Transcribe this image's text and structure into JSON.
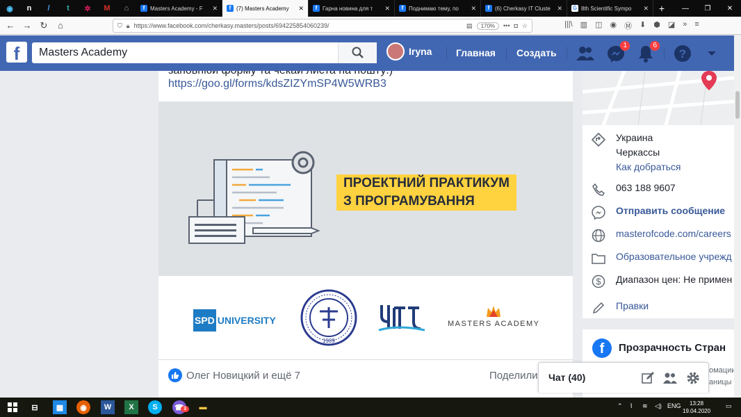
{
  "browser": {
    "tabs": [
      {
        "title": "Masters Academy - F",
        "active": false
      },
      {
        "title": "(7) Masters Academy",
        "active": true
      },
      {
        "title": "Гарна новина для т",
        "active": false
      },
      {
        "title": "Поднимаю тему, по",
        "active": false
      },
      {
        "title": "(6) Cherkasy IT Cluste",
        "active": false
      },
      {
        "title": "8th Scientific Sympo",
        "active": false
      }
    ],
    "url": "https://www.facebook.com/cherkasy.masters/posts/694225854060239/",
    "zoom": "170%"
  },
  "header": {
    "search_value": "Masters Academy",
    "user_name": "Iryna",
    "nav_home": "Главная",
    "nav_create": "Создать",
    "messenger_badge": "1",
    "notifications_badge": "6"
  },
  "post": {
    "text_fragment": "заповнюи форму та чекаи листа на пошту:)",
    "link": "https://goo.gl/forms/kdsZIZYmSP4W5WRB3",
    "banner_line1": "ПРОЕКТНИЙ ПРАКТИКУМ",
    "banner_line2": "З ПРОГРАМУВАННЯ",
    "logo_spd_box": "SPD",
    "logo_spd_text": "UNIVERSITY",
    "logo_fts_year": "1989",
    "logo_masters": "MASTERS ACADEMY",
    "reactions": "Олег Новицкий и ещё 7",
    "share": "Поделили"
  },
  "sidebar": {
    "country": "Украина",
    "city": "Черкассы",
    "directions": "Как добраться",
    "phone": "063 188 9607",
    "message": "Отправить сообщение",
    "website": "masterofcode.com/careers",
    "category": "Образовательное учрежд",
    "price_range": "Диапазон цен: Не примен",
    "edits": "Правки",
    "transparency_title": "Прозрачность Стран",
    "transparency_sub1": "омации",
    "transparency_sub2": "аницы"
  },
  "chat": {
    "label": "Чат (40)"
  },
  "taskbar": {
    "lang": "ENG",
    "time": "13:28",
    "date": "19.04.2020",
    "notif_badge": "3"
  },
  "colors": {
    "fb_blue": "#4267b2",
    "link_blue": "#385898",
    "banner_yellow": "#ffd23f"
  }
}
